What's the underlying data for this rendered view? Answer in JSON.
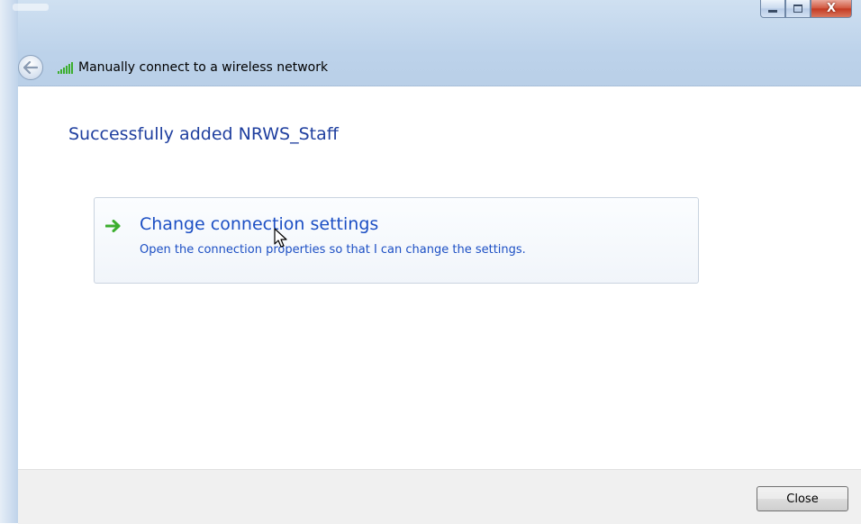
{
  "window": {
    "caption_buttons": {
      "minimize_icon": "minimize-icon",
      "maximize_icon": "maximize-icon",
      "close_glyph": "X"
    }
  },
  "header": {
    "back_icon": "back-arrow-icon",
    "signal_icon": "wireless-signal-icon",
    "title": "Manually connect to a wireless network"
  },
  "content": {
    "success_message": "Successfully added NRWS_Staff",
    "command_link": {
      "icon": "green-arrow-icon",
      "title": "Change connection settings",
      "description": "Open the connection properties so that I can change the settings."
    }
  },
  "footer": {
    "close_label": "Close"
  },
  "colors": {
    "link_blue": "#1c4fc4",
    "heading_blue": "#1f3f9f",
    "arrow_green": "#3cae2e"
  }
}
